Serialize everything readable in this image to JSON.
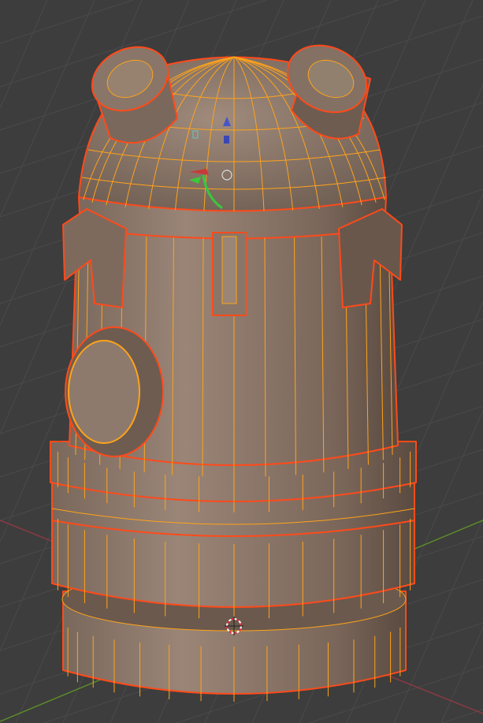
{
  "viewport": {
    "background": "#3d3d3d",
    "grid_color": "#4a4a4a",
    "x_axis_color": "#8a3a45",
    "y_axis_color": "#5c8a2a"
  },
  "model": {
    "base_color": "#8c786a",
    "shade_color": "#5e4f45",
    "wire_color": "#ffa31a",
    "outline_color": "#ff4a1a"
  }
}
